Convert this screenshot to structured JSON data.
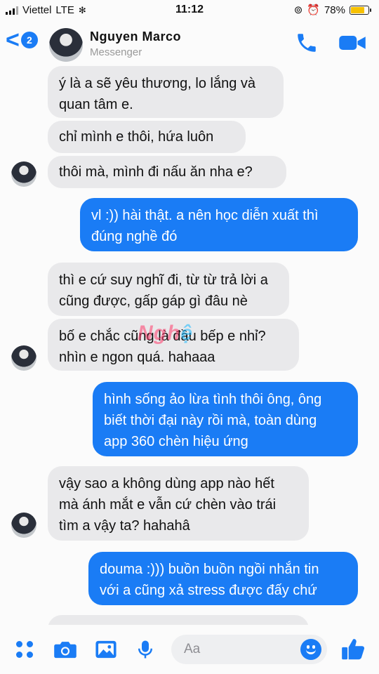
{
  "status_bar": {
    "carrier": "Viettel",
    "network": "LTE",
    "time": "11:12",
    "battery": "78%",
    "battery_level": 0.78
  },
  "header": {
    "back_badge": "2",
    "contact_name": "Nguyen Marco",
    "subtitle": "Messenger"
  },
  "messages": [
    {
      "from": "them",
      "text": "ý là a sẽ yêu thương, lo lắng và\nquan tâm e."
    },
    {
      "from": "them",
      "text": "chỉ mình e thôi, hứa luôn"
    },
    {
      "from": "them",
      "text": "thôi mà, mình đi nấu ăn nha e?"
    },
    {
      "from": "me",
      "text": "vl :)) hài thật. a nên học diễn xuất thì\nđúng nghề đó"
    },
    {
      "from": "them",
      "text": "thì e cứ suy nghĩ đi, từ từ trả lời a\ncũng được, gấp gáp gì đâu nè"
    },
    {
      "from": "them",
      "text": "bố e chắc cũng là đầu bếp e nhỉ?\nnhìn e ngon quá. hahaaa"
    },
    {
      "from": "me",
      "text": "hình sống ảo lừa tình thôi ông, ông\nbiết thời đại này rồi mà, toàn dùng\napp 360 chèn hiệu ứng"
    },
    {
      "from": "them",
      "text": "vậy sao a không dùng app nào hết\nmà ánh mắt e vẫn cứ chèn vào trái\ntìm a vậy ta? hahahâ"
    },
    {
      "from": "me",
      "text": "douma :))) buồn buồn ngồi nhắn tin\nvới a cũng xả stress được đấy chứ"
    }
  ],
  "watermark": {
    "part1": "Ngh",
    "part2": "ệ"
  },
  "composer": {
    "placeholder": "Aa"
  },
  "colors": {
    "accent": "#1a7cf5",
    "incoming_bubble": "#e9e9eb"
  },
  "icons": [
    "apps-icon",
    "camera-icon",
    "photo-icon",
    "microphone-icon",
    "emoji-icon",
    "thumbs-up-icon",
    "phone-icon",
    "video-camera-icon"
  ]
}
